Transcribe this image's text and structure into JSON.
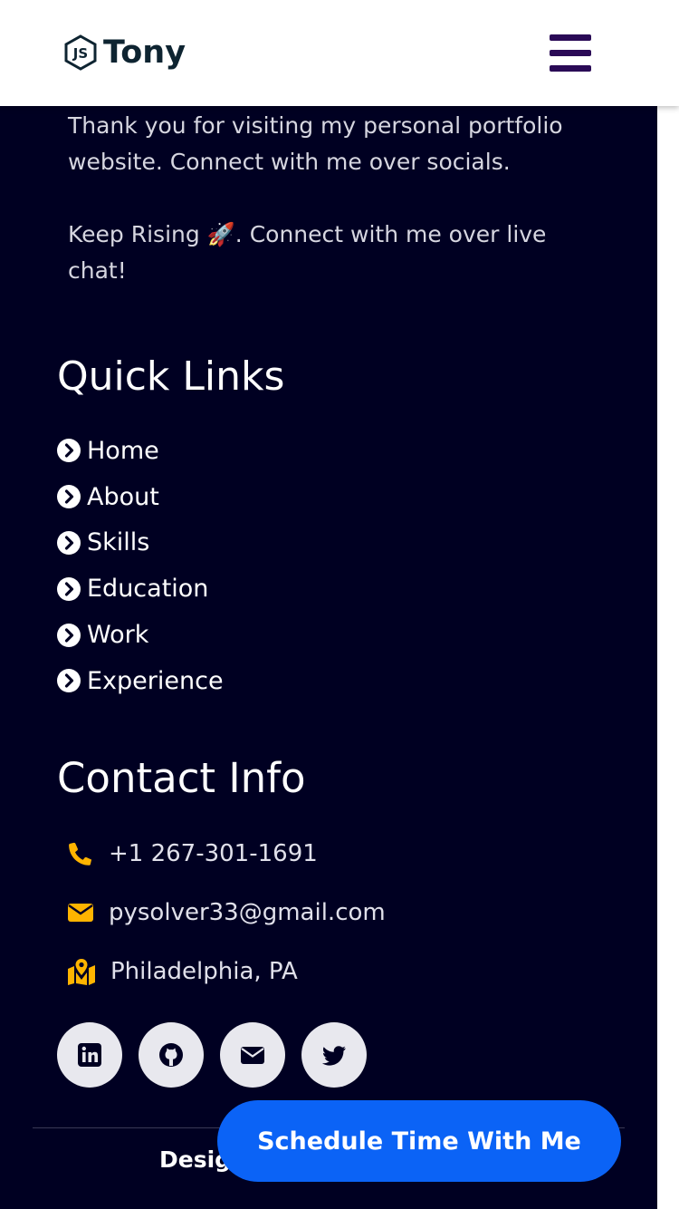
{
  "header": {
    "logo_text": "Tony",
    "logo_icon": "js-hexagon-icon",
    "menu_icon": "hamburger-menu-icon"
  },
  "about": {
    "paragraph1": "Thank you for visiting my personal portfolio website. Connect with me over socials.",
    "paragraph2": "Keep Rising 🚀. Connect with me over live chat!"
  },
  "quick_links": {
    "title": "Quick Links",
    "items": [
      {
        "label": "Home"
      },
      {
        "label": "About"
      },
      {
        "label": "Skills"
      },
      {
        "label": "Education"
      },
      {
        "label": "Work"
      },
      {
        "label": "Experience"
      }
    ]
  },
  "contact": {
    "title": "Contact Info",
    "phone": "+1 267-301-1691",
    "email": "pysolver33@gmail.com",
    "location": "Philadelphia, PA"
  },
  "socials": [
    "linkedin-icon",
    "github-icon",
    "mail-icon",
    "twitter-icon"
  ],
  "footer": {
    "credit_visible": "Desig"
  },
  "cta": {
    "label": "Schedule Time With Me"
  },
  "colors": {
    "footer_bg": "#000022",
    "accent": "#ffb400",
    "cta": "#0b63f6",
    "hamburger": "#2a0a56"
  }
}
